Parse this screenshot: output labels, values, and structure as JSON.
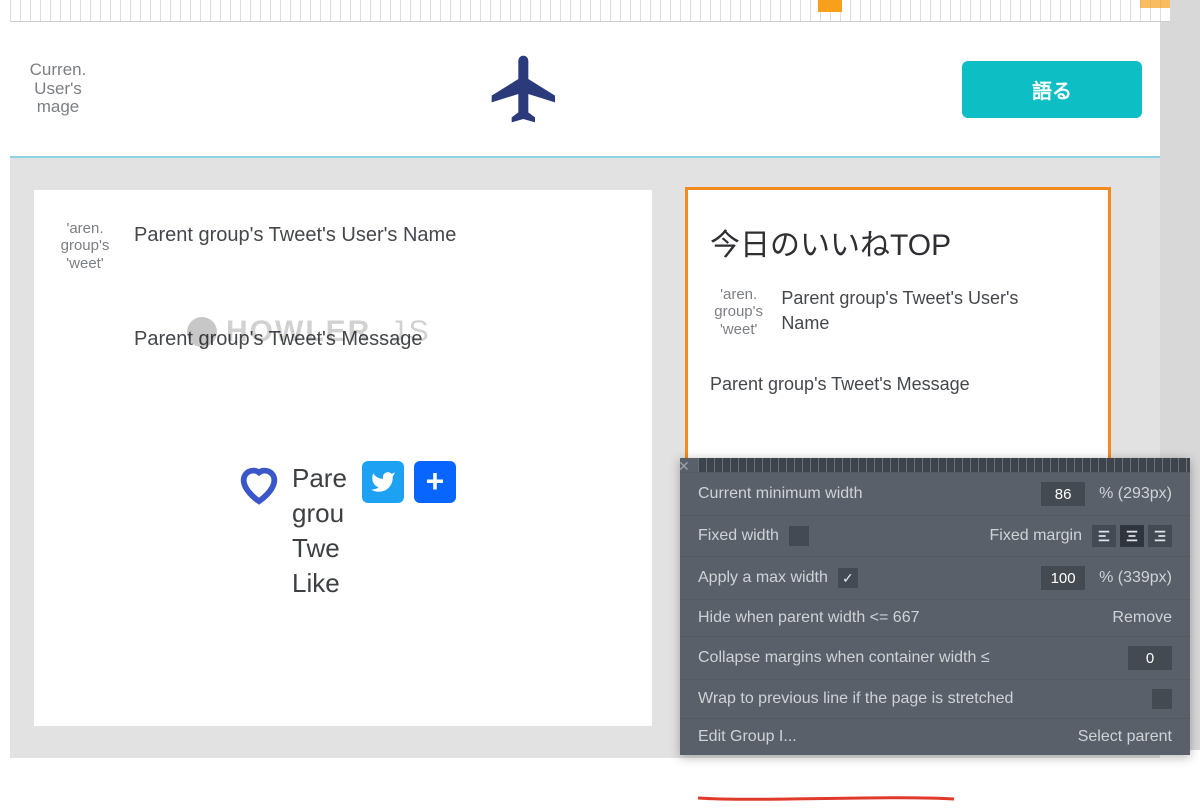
{
  "header": {
    "avatar_label": "Curren. User's mage",
    "talk_label": "語る"
  },
  "left_card": {
    "avatar_label": "'aren. group's 'weet'",
    "username": "Parent group's Tweet's User's Name",
    "message": "Parent group's Tweet's Message",
    "howler_text": "HOWLER",
    "howler_suffix": ".JS",
    "like_text": "Pare grou Twe Like"
  },
  "right_card": {
    "title": "今日のいいねTOP",
    "avatar_label": "'aren. group's 'weet'",
    "username": "Parent group's Tweet's User's Name",
    "message": "Parent group's Tweet's Message"
  },
  "panel": {
    "min_width_label": "Current minimum width",
    "min_width_value": "86",
    "min_width_pct": "%  (293px)",
    "fixed_width_label": "Fixed width",
    "fixed_margin_label": "Fixed margin",
    "apply_max_label": "Apply a max width",
    "max_value": "100",
    "max_pct": "%  (339px)",
    "hide_label": "Hide when parent width <= 667",
    "remove_label": "Remove",
    "collapse_label": "Collapse margins when container width ≤",
    "collapse_value": "0",
    "wrap_label": "Wrap to previous line if the page is stretched",
    "edit_group_label": "Edit Group I...",
    "select_parent_label": "Select parent"
  }
}
